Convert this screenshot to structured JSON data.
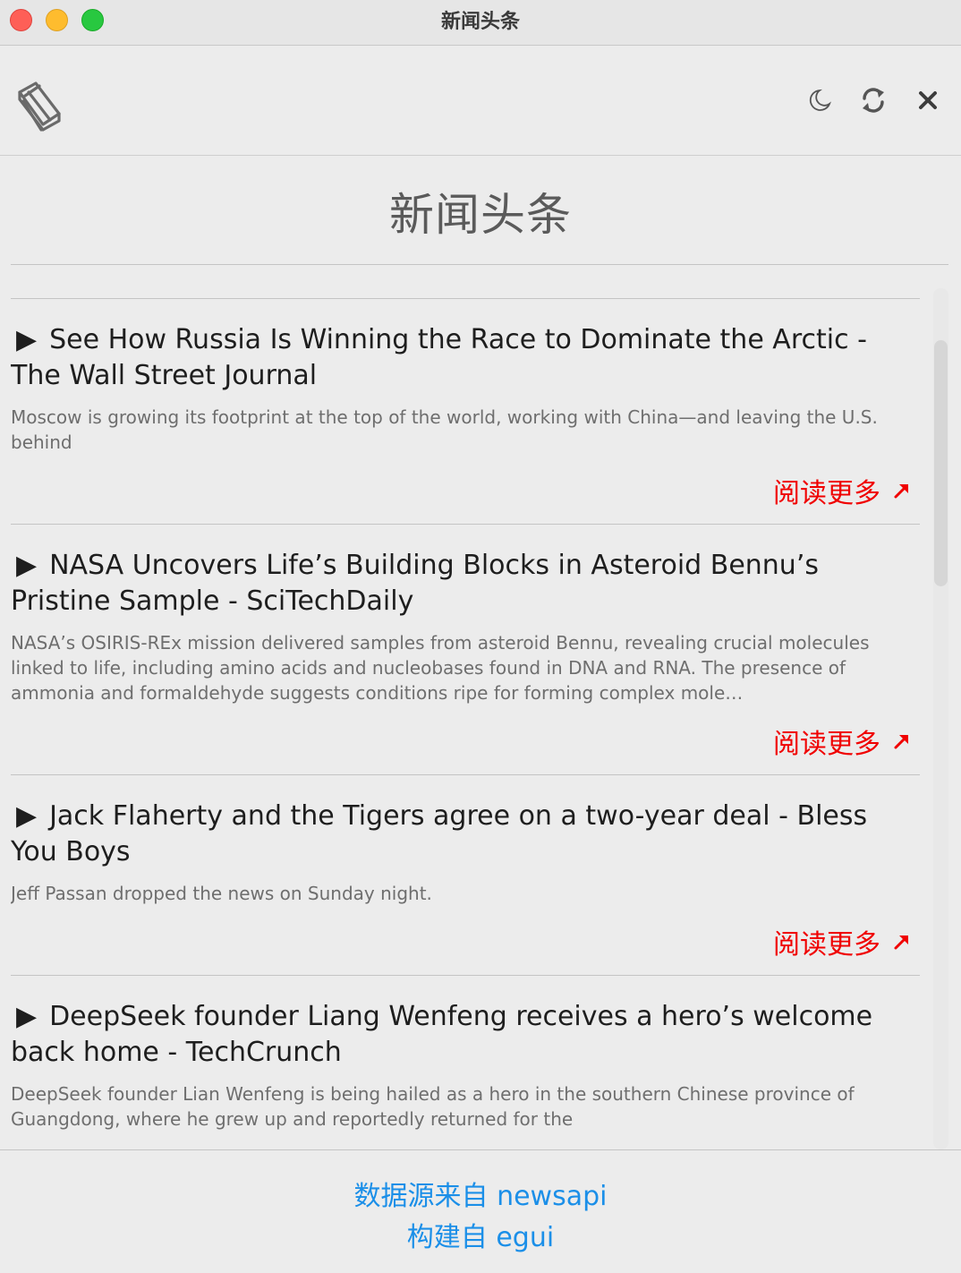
{
  "window": {
    "title": "新闻头条"
  },
  "toolbar": {
    "app_icon": "newspaper-icon",
    "buttons": [
      {
        "name": "theme-toggle-button",
        "icon": "moon-icon"
      },
      {
        "name": "refresh-button",
        "icon": "refresh-icon"
      },
      {
        "name": "close-button",
        "icon": "close-icon"
      }
    ]
  },
  "main": {
    "heading": "新闻头条",
    "articles": [
      {
        "arrow": "▶",
        "title": "See How Russia Is Winning the Race to Dominate the Arctic - The Wall Street Journal",
        "description": "Moscow is growing its footprint at the top of the world, working with China—and leaving the U.S. behind",
        "read_more": "阅读更多"
      },
      {
        "arrow": "▶",
        "title": "NASA Uncovers Life’s Building Blocks in Asteroid Bennu’s Pristine Sample - SciTechDaily",
        "description": "NASA’s OSIRIS-REx mission delivered samples from asteroid Bennu, revealing crucial molecules linked to life, including amino acids and nucleobases found in DNA and RNA. The presence of ammonia and formaldehyde suggests conditions ripe for forming complex mole…",
        "read_more": "阅读更多"
      },
      {
        "arrow": "▶",
        "title": "Jack Flaherty and the Tigers agree on a two-year deal - Bless You Boys",
        "description": "Jeff Passan dropped the news on Sunday night.",
        "read_more": "阅读更多"
      },
      {
        "arrow": "▶",
        "title": "DeepSeek founder Liang Wenfeng receives a hero’s welcome back home - TechCrunch",
        "description": "DeepSeek founder Lian Wenfeng is being hailed as a hero in the southern Chinese province of Guangdong, where he grew up and reportedly returned for the",
        "read_more": ""
      }
    ]
  },
  "footer": {
    "data_source": "数据源来自 newsapi",
    "built_with": "构建自 egui"
  },
  "colors": {
    "read_more": "#f00000",
    "footer_link": "#1b8fe8"
  }
}
